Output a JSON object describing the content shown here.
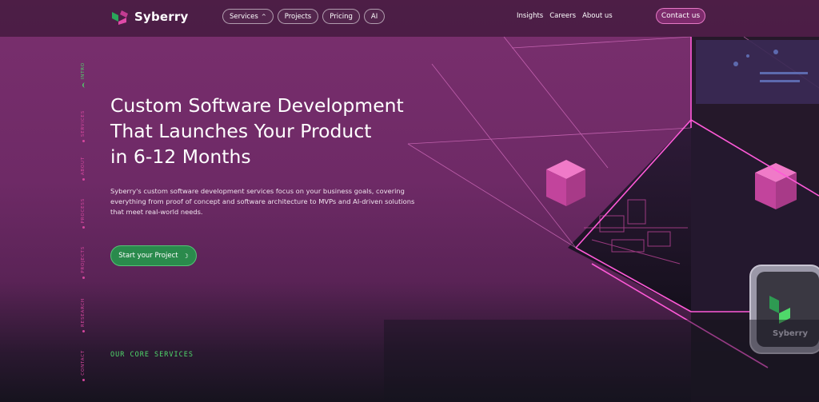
{
  "brand": {
    "name": "Syberry",
    "colors": {
      "accent_green": "#2a8a4c",
      "accent_pink": "#e04aa8",
      "bg": "#6e2a66"
    }
  },
  "nav": {
    "items": [
      {
        "label": "Services",
        "has_dropdown": true
      },
      {
        "label": "Projects"
      },
      {
        "label": "Pricing"
      },
      {
        "label": "AI"
      }
    ],
    "links": [
      "Insights",
      "Careers",
      "About us"
    ],
    "contact_label": "Contact us"
  },
  "sidenav": {
    "items": [
      {
        "label": "INTRO",
        "active": true
      },
      {
        "label": "SERVICES"
      },
      {
        "label": "ABOUT"
      },
      {
        "label": "PROCESS"
      },
      {
        "label": "PROJECTS"
      },
      {
        "label": "RESEARCH"
      },
      {
        "label": "CONTACT"
      }
    ]
  },
  "hero": {
    "headline_lines": [
      "Custom Software Development",
      "That Launches Your Product",
      "in 6-12 Months"
    ],
    "description": "Syberry's custom software development services focus on your business goals, covering everything from proof of concept and software architecture to MVPs and AI-driven solutions that meet real-world needs.",
    "cta_label": "Start your Project",
    "cta_icon": "crescent-arrow-icon"
  },
  "section": {
    "core_services_label": "OUR CORE SERVICES"
  },
  "hero_art": {
    "device_brand_text": "Syberry"
  }
}
